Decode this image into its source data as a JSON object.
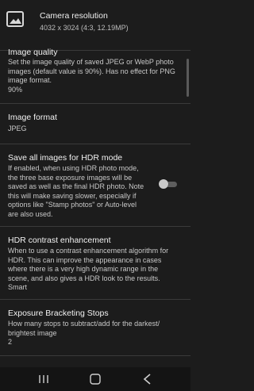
{
  "camera_resolution": {
    "title": "Camera resolution",
    "value": "4032 x 3024 (4:3, 12.19MP)",
    "icon": "image-icon"
  },
  "image_quality": {
    "title": "Image quality",
    "description_lines": [
      "Set the image quality of saved JPEG or WebP photo",
      "images (default value is 90%). Has no effect for PNG",
      "image format."
    ],
    "value": "90%"
  },
  "image_format": {
    "title": "Image format",
    "value": "JPEG"
  },
  "save_all_hdr": {
    "title": "Save all images for HDR mode",
    "description_lines": [
      "If enabled, when using HDR photo mode,",
      "the three base exposure images will be",
      "saved as well as the final HDR photo. Note",
      "this will make saving slower, especially if",
      "options like \"Stamp photos\" or Auto-level",
      "are also used."
    ],
    "enabled": false
  },
  "hdr_contrast": {
    "title": "HDR contrast enhancement",
    "description_lines": [
      "When to use a contrast enhancement algorithm for",
      "HDR. This can improve the appearance in cases",
      "where there is a very high dynamic range in the",
      "scene, and also gives a HDR look to the results."
    ],
    "value": "Smart"
  },
  "exposure_bracketing": {
    "title": "Exposure Bracketing Stops",
    "description_lines": [
      "How many stops to subtract/add for the darkest/",
      "brightest image"
    ],
    "value": "2"
  },
  "nav": {
    "recents": "recents-icon",
    "home": "home-icon",
    "back": "back-icon"
  }
}
